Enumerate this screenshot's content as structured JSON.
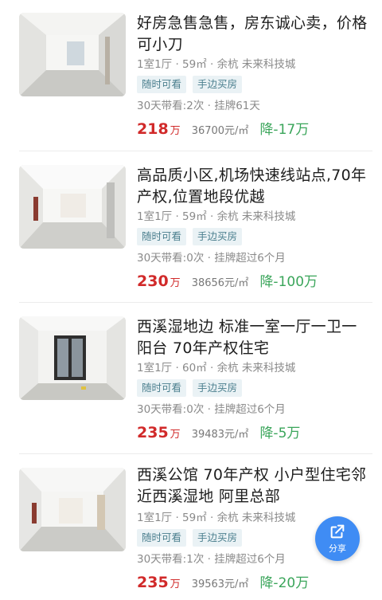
{
  "listings": [
    {
      "title": "好房急售急售，房东诚心卖，价格可小刀",
      "meta": "1室1厅 · 59㎡ · 余杭 未来科技城",
      "tags": [
        "随时可看",
        "手边买房"
      ],
      "stats": "30天带看:2次 · 挂牌61天",
      "price": "218",
      "price_unit": "万",
      "unit_price": "36700元/㎡",
      "drop": "降-17万"
    },
    {
      "title": "高品质小区,机场快速线站点,70年产权,位置地段优越",
      "meta": "1室1厅 · 59㎡ · 余杭 未来科技城",
      "tags": [
        "随时可看",
        "手边买房"
      ],
      "stats": "30天带看:0次 · 挂牌超过6个月",
      "price": "230",
      "price_unit": "万",
      "unit_price": "38656元/㎡",
      "drop": "降-100万"
    },
    {
      "title": "西溪湿地边 标准一室一厅一卫一阳台 70年产权住宅",
      "meta": "1室1厅 · 60㎡ · 余杭 未来科技城",
      "tags": [
        "随时可看",
        "手边买房"
      ],
      "stats": "30天带看:0次 · 挂牌超过6个月",
      "price": "235",
      "price_unit": "万",
      "unit_price": "39483元/㎡",
      "drop": "降-5万"
    },
    {
      "title": "西溪公馆 70年产权 小户型住宅邻近西溪湿地 阿里总部",
      "meta": "1室1厅 · 59㎡ · 余杭 未来科技城",
      "tags": [
        "随时可看",
        "手边买房"
      ],
      "stats": "30天带看:1次 · 挂牌超过6个月",
      "price": "235",
      "price_unit": "万",
      "unit_price": "39563元/㎡",
      "drop": "降-20万"
    }
  ],
  "share_button": {
    "label": "分享",
    "icon": "share-icon"
  },
  "colors": {
    "price": "#d12a2a",
    "drop": "#3aa55a",
    "tag_text": "#4b7f8e",
    "tag_bg": "#eaf2f5",
    "share_bg": "#3f8cf4"
  }
}
